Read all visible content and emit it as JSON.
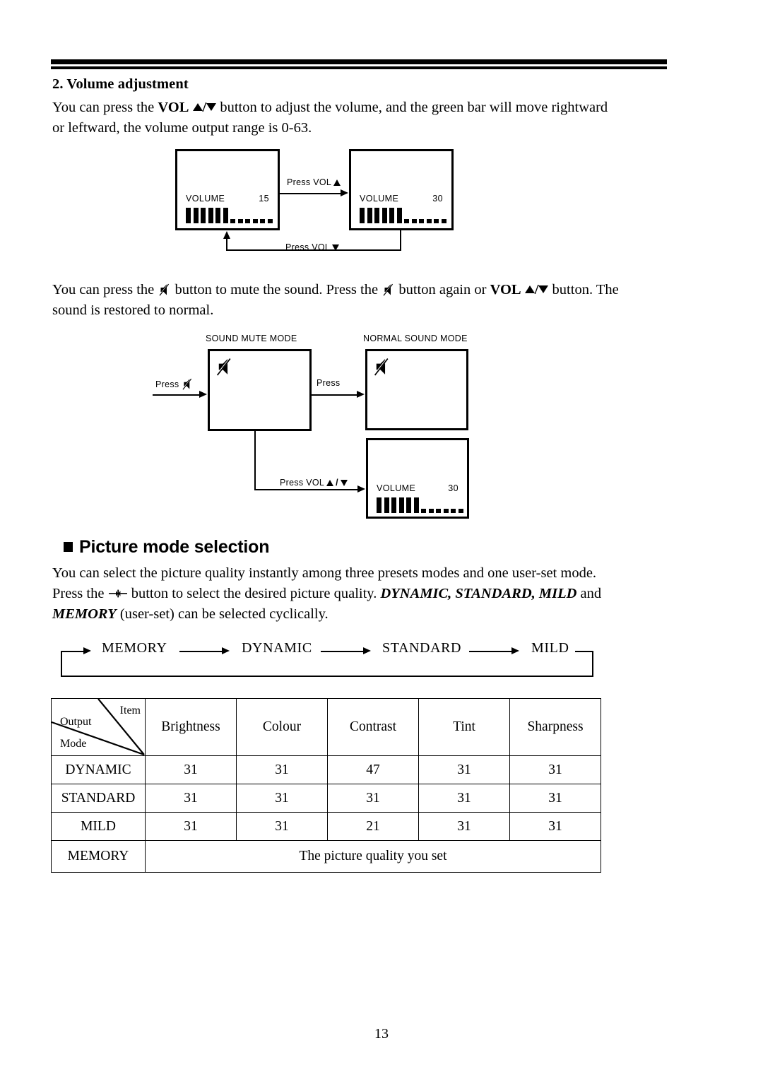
{
  "page": {
    "number": "13"
  },
  "section": {
    "number_title": "2. Volume adjustment",
    "volume_paragraph": {
      "part1": "You can press the ",
      "vol_label": "VOL",
      "part2": " button to adjust the volume, and the green bar will move rightward or leftward, the volume output range is 0-63."
    },
    "mute_paragraph": {
      "part1": "You can press the ",
      "part2": " button to mute the sound. Press the ",
      "part3": " button again or ",
      "vol_label": "VOL",
      "part4": " button. The sound is restored to normal."
    }
  },
  "volume_diagram": {
    "screen_left": {
      "osd_label": "VOLUME",
      "osd_value": "15",
      "segments_on": 6,
      "segments_off": 6
    },
    "screen_right": {
      "osd_label": "VOLUME",
      "osd_value": "30",
      "segments_on": 6,
      "segments_off": 6
    },
    "arrow_top_label": "Press VOL",
    "arrow_bottom_label": "Press VOL"
  },
  "mute_diagram": {
    "press_in_label": "Press",
    "mute_box_title": "SOUND MUTE MODE",
    "normal_box_title": "NORMAL SOUND MODE",
    "press_middle_label": "Press",
    "press_vol_label": "Press VOL",
    "volume_screen": {
      "osd_label": "VOLUME",
      "osd_value": "30",
      "segments_on": 6,
      "segments_off": 6
    },
    "mute_icon_name": "speaker-mute-icon"
  },
  "picture_section": {
    "heading": "Picture mode selection",
    "paragraph": {
      "line1": "You can select the picture quality instantly among three presets modes and one user-set mode.",
      "line2_pre": "Press the ",
      "line2_post": " button to select the desired picture quality. ",
      "modes_emph": "DYNAMIC, STANDARD, MILD",
      "line2_tail": " and ",
      "memory_emph": "MEMORY",
      "line3_tail": " (user-set) can be selected cyclically."
    },
    "cycle": [
      "MEMORY",
      "DYNAMIC",
      "STANDARD",
      "MILD"
    ]
  },
  "table": {
    "corner": {
      "item": "Item",
      "output": "Output",
      "mode": "Mode"
    },
    "columns": [
      "Brightness",
      "Colour",
      "Contrast",
      "Tint",
      "Sharpness"
    ],
    "rows": [
      {
        "mode": "DYNAMIC",
        "values": [
          "31",
          "31",
          "47",
          "31",
          "31"
        ]
      },
      {
        "mode": "STANDARD",
        "values": [
          "31",
          "31",
          "31",
          "31",
          "31"
        ]
      },
      {
        "mode": "MILD",
        "values": [
          "31",
          "31",
          "21",
          "31",
          "31"
        ]
      }
    ],
    "memory_row": {
      "mode": "MEMORY",
      "text": "The picture quality you set"
    }
  }
}
